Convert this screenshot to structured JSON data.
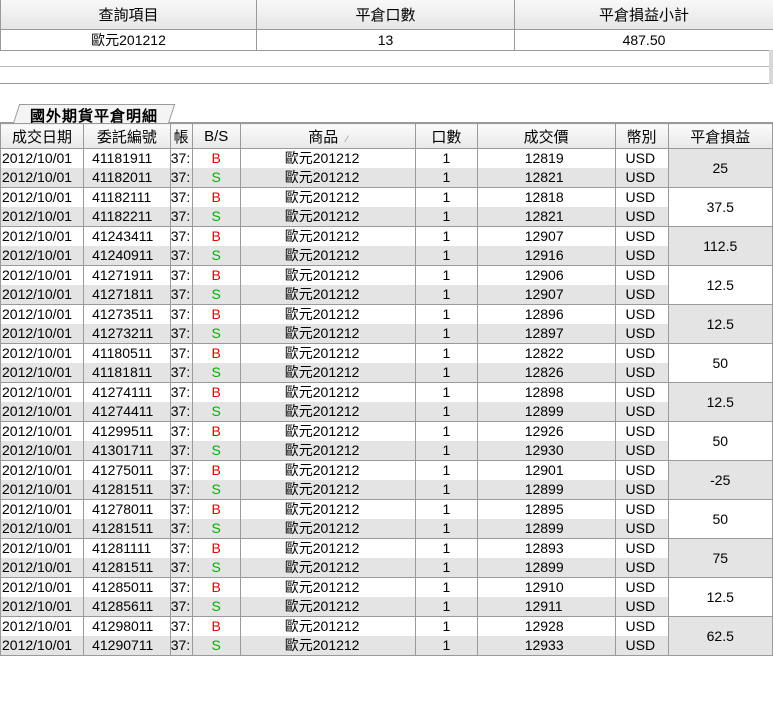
{
  "summary": {
    "headers": [
      "查詢項目",
      "平倉口數",
      "平倉損益小計"
    ],
    "row": {
      "item": "歐元201212",
      "qty": "13",
      "subtotal": "487.50"
    }
  },
  "tab": {
    "label": "國外期貨平倉明細"
  },
  "detail": {
    "headers": [
      "成交日期",
      "委託編號",
      "帳",
      "B/S",
      "商品",
      "口數",
      "成交價",
      "幣別",
      "平倉損益"
    ],
    "sort_indicator": "⁄",
    "account_fragment": "37:",
    "colors": {
      "buy": "#e00000",
      "sell": "#00b000"
    },
    "pairs": [
      {
        "pl": "25",
        "buy": {
          "date": "2012/10/01",
          "order": "41181911",
          "bs": "B",
          "product": "歐元201212",
          "qty": "1",
          "price": "12819",
          "currency": "USD"
        },
        "sell": {
          "date": "2012/10/01",
          "order": "41182011",
          "bs": "S",
          "product": "歐元201212",
          "qty": "1",
          "price": "12821",
          "currency": "USD"
        }
      },
      {
        "pl": "37.5",
        "buy": {
          "date": "2012/10/01",
          "order": "41182111",
          "bs": "B",
          "product": "歐元201212",
          "qty": "1",
          "price": "12818",
          "currency": "USD"
        },
        "sell": {
          "date": "2012/10/01",
          "order": "41182211",
          "bs": "S",
          "product": "歐元201212",
          "qty": "1",
          "price": "12821",
          "currency": "USD"
        }
      },
      {
        "pl": "112.5",
        "buy": {
          "date": "2012/10/01",
          "order": "41243411",
          "bs": "B",
          "product": "歐元201212",
          "qty": "1",
          "price": "12907",
          "currency": "USD"
        },
        "sell": {
          "date": "2012/10/01",
          "order": "41240911",
          "bs": "S",
          "product": "歐元201212",
          "qty": "1",
          "price": "12916",
          "currency": "USD"
        }
      },
      {
        "pl": "12.5",
        "buy": {
          "date": "2012/10/01",
          "order": "41271911",
          "bs": "B",
          "product": "歐元201212",
          "qty": "1",
          "price": "12906",
          "currency": "USD"
        },
        "sell": {
          "date": "2012/10/01",
          "order": "41271811",
          "bs": "S",
          "product": "歐元201212",
          "qty": "1",
          "price": "12907",
          "currency": "USD"
        }
      },
      {
        "pl": "12.5",
        "buy": {
          "date": "2012/10/01",
          "order": "41273511",
          "bs": "B",
          "product": "歐元201212",
          "qty": "1",
          "price": "12896",
          "currency": "USD"
        },
        "sell": {
          "date": "2012/10/01",
          "order": "41273211",
          "bs": "S",
          "product": "歐元201212",
          "qty": "1",
          "price": "12897",
          "currency": "USD"
        }
      },
      {
        "pl": "50",
        "buy": {
          "date": "2012/10/01",
          "order": "41180511",
          "bs": "B",
          "product": "歐元201212",
          "qty": "1",
          "price": "12822",
          "currency": "USD"
        },
        "sell": {
          "date": "2012/10/01",
          "order": "41181811",
          "bs": "S",
          "product": "歐元201212",
          "qty": "1",
          "price": "12826",
          "currency": "USD"
        }
      },
      {
        "pl": "12.5",
        "buy": {
          "date": "2012/10/01",
          "order": "41274111",
          "bs": "B",
          "product": "歐元201212",
          "qty": "1",
          "price": "12898",
          "currency": "USD"
        },
        "sell": {
          "date": "2012/10/01",
          "order": "41274411",
          "bs": "S",
          "product": "歐元201212",
          "qty": "1",
          "price": "12899",
          "currency": "USD"
        }
      },
      {
        "pl": "50",
        "buy": {
          "date": "2012/10/01",
          "order": "41299511",
          "bs": "B",
          "product": "歐元201212",
          "qty": "1",
          "price": "12926",
          "currency": "USD"
        },
        "sell": {
          "date": "2012/10/01",
          "order": "41301711",
          "bs": "S",
          "product": "歐元201212",
          "qty": "1",
          "price": "12930",
          "currency": "USD"
        }
      },
      {
        "pl": "-25",
        "buy": {
          "date": "2012/10/01",
          "order": "41275011",
          "bs": "B",
          "product": "歐元201212",
          "qty": "1",
          "price": "12901",
          "currency": "USD"
        },
        "sell": {
          "date": "2012/10/01",
          "order": "41281511",
          "bs": "S",
          "product": "歐元201212",
          "qty": "1",
          "price": "12899",
          "currency": "USD"
        }
      },
      {
        "pl": "50",
        "buy": {
          "date": "2012/10/01",
          "order": "41278011",
          "bs": "B",
          "product": "歐元201212",
          "qty": "1",
          "price": "12895",
          "currency": "USD"
        },
        "sell": {
          "date": "2012/10/01",
          "order": "41281511",
          "bs": "S",
          "product": "歐元201212",
          "qty": "1",
          "price": "12899",
          "currency": "USD"
        }
      },
      {
        "pl": "75",
        "buy": {
          "date": "2012/10/01",
          "order": "41281111",
          "bs": "B",
          "product": "歐元201212",
          "qty": "1",
          "price": "12893",
          "currency": "USD"
        },
        "sell": {
          "date": "2012/10/01",
          "order": "41281511",
          "bs": "S",
          "product": "歐元201212",
          "qty": "1",
          "price": "12899",
          "currency": "USD"
        }
      },
      {
        "pl": "12.5",
        "buy": {
          "date": "2012/10/01",
          "order": "41285011",
          "bs": "B",
          "product": "歐元201212",
          "qty": "1",
          "price": "12910",
          "currency": "USD"
        },
        "sell": {
          "date": "2012/10/01",
          "order": "41285611",
          "bs": "S",
          "product": "歐元201212",
          "qty": "1",
          "price": "12911",
          "currency": "USD"
        }
      },
      {
        "pl": "62.5",
        "buy": {
          "date": "2012/10/01",
          "order": "41298011",
          "bs": "B",
          "product": "歐元201212",
          "qty": "1",
          "price": "12928",
          "currency": "USD"
        },
        "sell": {
          "date": "2012/10/01",
          "order": "41290711",
          "bs": "S",
          "product": "歐元201212",
          "qty": "1",
          "price": "12933",
          "currency": "USD"
        }
      }
    ]
  }
}
